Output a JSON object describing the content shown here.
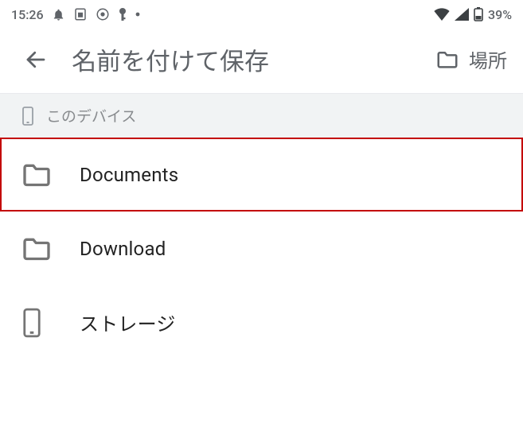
{
  "status_bar": {
    "time": "15:26",
    "battery_text": "39%"
  },
  "app_bar": {
    "title": "名前を付けて保存",
    "locations_label": "場所"
  },
  "section": {
    "label": "このデバイス"
  },
  "items": [
    {
      "label": "Documents"
    },
    {
      "label": "Download"
    },
    {
      "label": "ストレージ"
    }
  ]
}
